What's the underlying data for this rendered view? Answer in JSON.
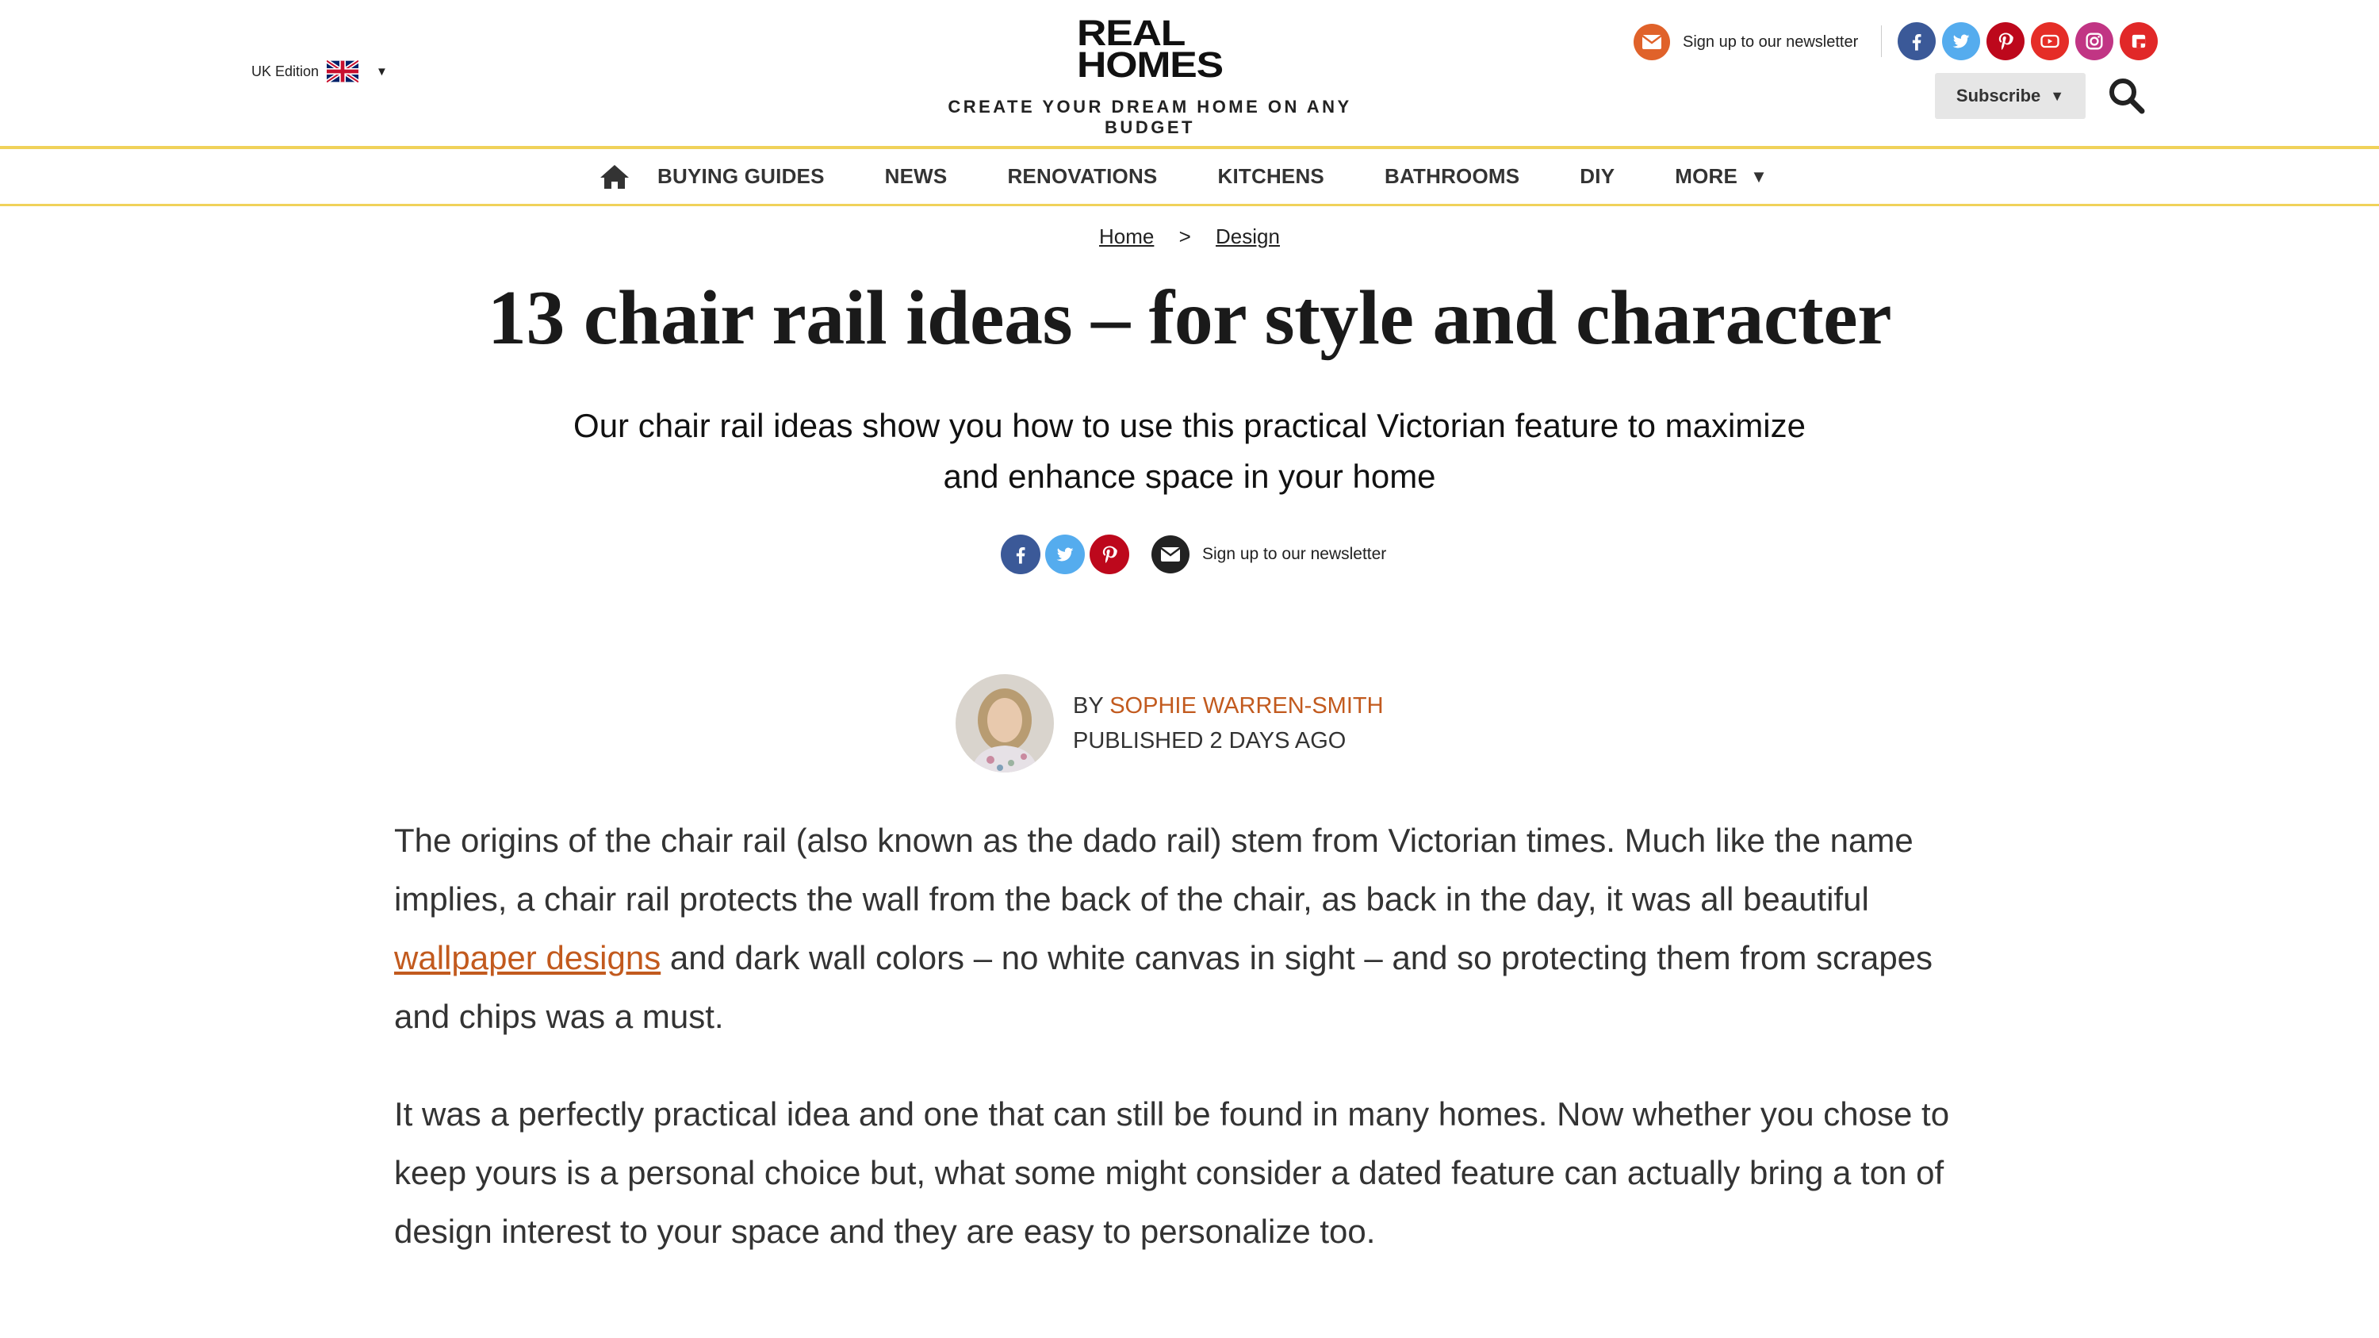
{
  "header": {
    "edition_label": "UK Edition",
    "edition_flag": "uk-flag",
    "logo_line1": "REAL",
    "logo_line2": "HOMES",
    "tagline": "CREATE YOUR DREAM HOME ON ANY BUDGET",
    "newsletter_label": "Sign up to our newsletter",
    "subscribe_label": "Subscribe",
    "socials": [
      {
        "name": "facebook",
        "icon": "facebook-icon",
        "color": "#3b5998"
      },
      {
        "name": "twitter",
        "icon": "twitter-icon",
        "color": "#55acee"
      },
      {
        "name": "pinterest",
        "icon": "pinterest-icon",
        "color": "#bd081c"
      },
      {
        "name": "youtube",
        "icon": "youtube-icon",
        "color": "#e52d27"
      },
      {
        "name": "instagram",
        "icon": "instagram-icon",
        "color": "#c13584"
      },
      {
        "name": "flipboard",
        "icon": "flipboard-icon",
        "color": "#e12828"
      }
    ]
  },
  "nav": {
    "home_icon": "home-icon",
    "items": [
      "BUYING GUIDES",
      "NEWS",
      "RENOVATIONS",
      "KITCHENS",
      "BATHROOMS",
      "DIY"
    ],
    "more_label": "MORE"
  },
  "breadcrumb": {
    "home": "Home",
    "separator": ">",
    "current": "Design"
  },
  "article": {
    "title": "13 chair rail ideas – for style and character",
    "subtitle": "Our chair rail ideas show you how to use this practical Victorian feature to maximize and enhance space in your home",
    "share_newsletter": "Sign up to our newsletter",
    "byline_prefix": "BY ",
    "author": "SOPHIE WARREN-SMITH",
    "published": "PUBLISHED 2 DAYS AGO",
    "para1_before": "The origins of the chair rail (also known as the dado rail) stem from Victorian times. Much like the name implies, a chair rail protects the wall from the back of the chair, as back in the day, it was all beautiful ",
    "para1_link": "wallpaper designs",
    "para1_after": " and dark wall colors – no white canvas in sight – and so protecting them from scrapes and chips was a must.",
    "para2": "It was a perfectly practical idea and one that can still be found in many homes. Now whether you chose to keep yours is a personal choice but, what some might consider a dated feature can actually bring a ton of design interest to your space and they are easy to personalize too."
  },
  "colors": {
    "accent": "#c25a1e",
    "nav_border": "#f0d25a",
    "newsletter_icon_bg": "#e0622a"
  }
}
